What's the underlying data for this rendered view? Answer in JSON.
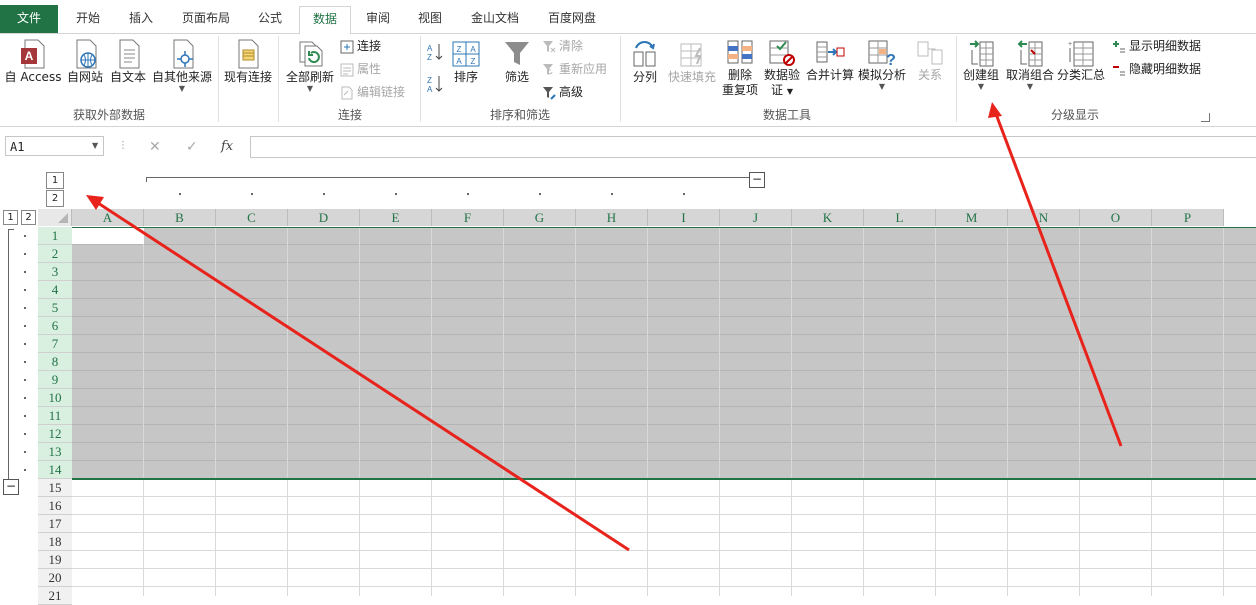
{
  "tabs": [
    {
      "label": "文件",
      "id": "file"
    },
    {
      "label": "开始",
      "id": "home"
    },
    {
      "label": "插入",
      "id": "insert"
    },
    {
      "label": "页面布局",
      "id": "layout"
    },
    {
      "label": "公式",
      "id": "formulas"
    },
    {
      "label": "数据",
      "id": "data"
    },
    {
      "label": "审阅",
      "id": "review"
    },
    {
      "label": "视图",
      "id": "view"
    },
    {
      "label": "金山文档",
      "id": "kdocs"
    },
    {
      "label": "百度网盘",
      "id": "baidu"
    }
  ],
  "ribbon": {
    "external": {
      "access": "自 Access",
      "web": "自网站",
      "text": "自文本",
      "other": "自其他来源",
      "group_label": "获取外部数据"
    },
    "existing": "现有连接",
    "connections": {
      "refresh_all": "全部刷新",
      "connect": "连接",
      "properties": "属性",
      "edit_links": "编辑链接",
      "group_label": "连接"
    },
    "sort_filter": {
      "sort": "排序",
      "filter": "筛选",
      "clear": "清除",
      "reapply": "重新应用",
      "advanced": "高级",
      "group_label": "排序和筛选"
    },
    "data_tools": {
      "split": "分列",
      "flash_fill": "快速填充",
      "remove_dup_1": "删除",
      "remove_dup_2": "重复项",
      "validation_1": "数据验",
      "validation_2": "证",
      "consolidate": "合并计算",
      "what_if": "模拟分析",
      "relations": "关系",
      "group_label": "数据工具"
    },
    "outline": {
      "group": "创建组",
      "ungroup": "取消组合",
      "subtotal": "分类汇总",
      "show_detail": "显示明细数据",
      "hide_detail": "隐藏明细数据",
      "group_label": "分级显示"
    }
  },
  "formula_bar": {
    "name_box": "A1",
    "cancel": "✕",
    "enter": "✓",
    "fx": "fx",
    "formula": ""
  },
  "outline_levels": {
    "col_level_1": "1",
    "col_level_2": "2",
    "row_level_1": "1",
    "row_level_2": "2",
    "collapse": "−"
  },
  "columns": [
    "A",
    "B",
    "C",
    "D",
    "E",
    "F",
    "G",
    "H",
    "I",
    "J",
    "K",
    "L",
    "M",
    "N",
    "O",
    "P"
  ],
  "rows": [
    "1",
    "2",
    "3",
    "4",
    "5",
    "6",
    "7",
    "8",
    "9",
    "10",
    "11",
    "12",
    "13",
    "14",
    "15",
    "16",
    "17",
    "18",
    "19",
    "20",
    "21"
  ],
  "selection": {
    "range": "A1:P14",
    "active_cell": "A1"
  },
  "colors": {
    "accent": "#217346",
    "selection_fill": "#c6c6c6",
    "annotation_arrow": "#e8231c"
  }
}
